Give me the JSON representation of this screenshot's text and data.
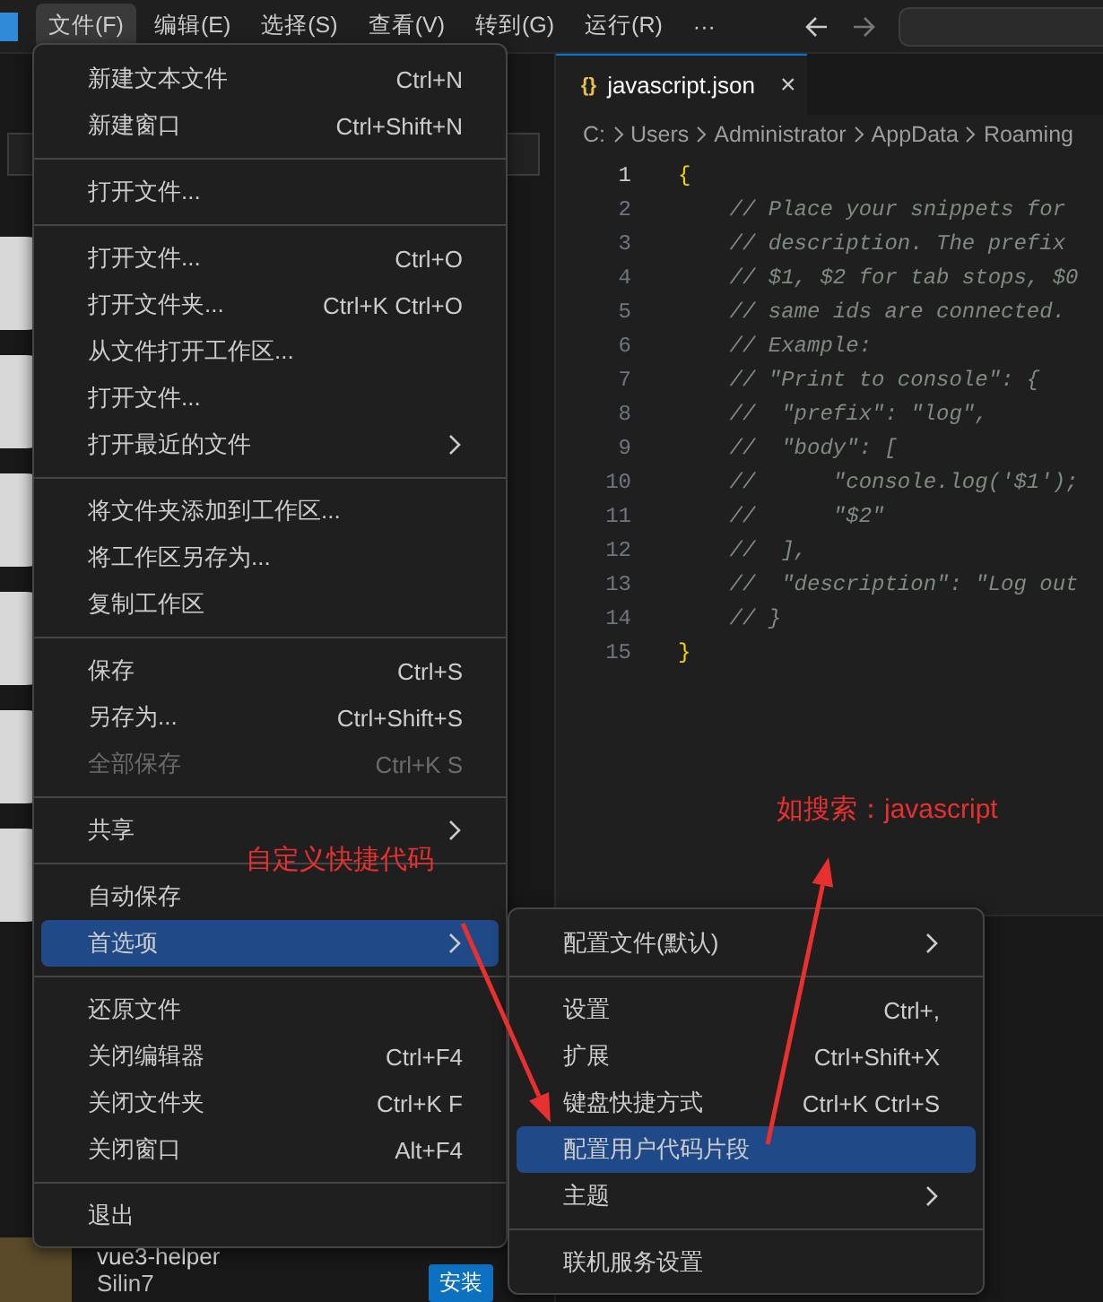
{
  "title_bar": {
    "menus": [
      {
        "label": "文件(F)",
        "selected": true
      },
      {
        "label": "编辑(E)",
        "selected": false
      },
      {
        "label": "选择(S)",
        "selected": false
      },
      {
        "label": "查看(V)",
        "selected": false
      },
      {
        "label": "转到(G)",
        "selected": false
      },
      {
        "label": "运行(R)",
        "selected": false
      },
      {
        "label": "···",
        "selected": false
      }
    ]
  },
  "sidebar": {
    "extension": {
      "name": "vue3-helper",
      "author": "Silin7",
      "button": "安装"
    }
  },
  "editor": {
    "tab": {
      "filename": "javascript.json",
      "icon": "{}",
      "close": "×"
    },
    "breadcrumb": [
      "C:",
      "Users",
      "Administrator",
      "AppData",
      "Roaming"
    ],
    "lines": [
      {
        "number": "1",
        "text": "{",
        "kind": "brace",
        "current": true
      },
      {
        "number": "2",
        "text": "    // Place your snippets for",
        "kind": "comment",
        "current": false
      },
      {
        "number": "3",
        "text": "    // description. The prefix",
        "kind": "comment",
        "current": false
      },
      {
        "number": "4",
        "text": "    // $1, $2 for tab stops, $0",
        "kind": "comment",
        "current": false
      },
      {
        "number": "5",
        "text": "    // same ids are connected.",
        "kind": "comment",
        "current": false
      },
      {
        "number": "6",
        "text": "    // Example:",
        "kind": "comment",
        "current": false
      },
      {
        "number": "7",
        "text": "    // \"Print to console\": {",
        "kind": "comment",
        "current": false
      },
      {
        "number": "8",
        "text": "    //  \"prefix\": \"log\",",
        "kind": "comment",
        "current": false
      },
      {
        "number": "9",
        "text": "    //  \"body\": [",
        "kind": "comment",
        "current": false
      },
      {
        "number": "10",
        "text": "    //      \"console.log('$1');",
        "kind": "comment",
        "current": false
      },
      {
        "number": "11",
        "text": "    //      \"$2\"",
        "kind": "comment",
        "current": false
      },
      {
        "number": "12",
        "text": "    //  ],",
        "kind": "comment",
        "current": false
      },
      {
        "number": "13",
        "text": "    //  \"description\": \"Log out",
        "kind": "comment",
        "current": false
      },
      {
        "number": "14",
        "text": "    // }",
        "kind": "comment",
        "current": false
      },
      {
        "number": "15",
        "text": "}",
        "kind": "brace",
        "current": false
      }
    ]
  },
  "file_menu": {
    "items": [
      {
        "kind": "item",
        "label": "新建文本文件",
        "shortcut": "Ctrl+N",
        "submenu": false,
        "disabled": false,
        "selected": false
      },
      {
        "kind": "item",
        "label": "新建窗口",
        "shortcut": "Ctrl+Shift+N",
        "submenu": false,
        "disabled": false,
        "selected": false
      },
      {
        "kind": "separator"
      },
      {
        "kind": "item",
        "label": "打开文件...",
        "submenu": false,
        "disabled": false,
        "selected": false
      },
      {
        "kind": "separator"
      },
      {
        "kind": "item",
        "label": "打开文件...",
        "shortcut": "Ctrl+O",
        "submenu": false,
        "disabled": false,
        "selected": false
      },
      {
        "kind": "item",
        "label": "打开文件夹...",
        "shortcut": "Ctrl+K Ctrl+O",
        "submenu": false,
        "disabled": false,
        "selected": false
      },
      {
        "kind": "item",
        "label": "从文件打开工作区...",
        "submenu": false,
        "disabled": false,
        "selected": false
      },
      {
        "kind": "item",
        "label": "打开文件...",
        "submenu": false,
        "disabled": false,
        "selected": false
      },
      {
        "kind": "item",
        "label": "打开最近的文件",
        "submenu": true,
        "disabled": false,
        "selected": false
      },
      {
        "kind": "separator"
      },
      {
        "kind": "item",
        "label": "将文件夹添加到工作区...",
        "submenu": false,
        "disabled": false,
        "selected": false
      },
      {
        "kind": "item",
        "label": "将工作区另存为...",
        "submenu": false,
        "disabled": false,
        "selected": false
      },
      {
        "kind": "item",
        "label": "复制工作区",
        "submenu": false,
        "disabled": false,
        "selected": false
      },
      {
        "kind": "separator"
      },
      {
        "kind": "item",
        "label": "保存",
        "shortcut": "Ctrl+S",
        "submenu": false,
        "disabled": false,
        "selected": false
      },
      {
        "kind": "item",
        "label": "另存为...",
        "shortcut": "Ctrl+Shift+S",
        "submenu": false,
        "disabled": false,
        "selected": false
      },
      {
        "kind": "item",
        "label": "全部保存",
        "shortcut": "Ctrl+K S",
        "submenu": false,
        "disabled": true,
        "selected": false
      },
      {
        "kind": "separator"
      },
      {
        "kind": "item",
        "label": "共享",
        "submenu": true,
        "disabled": false,
        "selected": false
      },
      {
        "kind": "separator"
      },
      {
        "kind": "item",
        "label": "自动保存",
        "submenu": false,
        "disabled": false,
        "selected": false
      },
      {
        "kind": "item",
        "label": "首选项",
        "submenu": true,
        "disabled": false,
        "selected": true
      },
      {
        "kind": "separator"
      },
      {
        "kind": "item",
        "label": "还原文件",
        "submenu": false,
        "disabled": false,
        "selected": false
      },
      {
        "kind": "item",
        "label": "关闭编辑器",
        "shortcut": "Ctrl+F4",
        "submenu": false,
        "disabled": false,
        "selected": false
      },
      {
        "kind": "item",
        "label": "关闭文件夹",
        "shortcut": "Ctrl+K F",
        "submenu": false,
        "disabled": false,
        "selected": false
      },
      {
        "kind": "item",
        "label": "关闭窗口",
        "shortcut": "Alt+F4",
        "submenu": false,
        "disabled": false,
        "selected": false
      },
      {
        "kind": "separator"
      },
      {
        "kind": "item",
        "label": "退出",
        "submenu": false,
        "disabled": false,
        "selected": false
      }
    ]
  },
  "preferences_submenu": {
    "items": [
      {
        "kind": "item",
        "label": "配置文件(默认)",
        "submenu": true,
        "disabled": false,
        "selected": false
      },
      {
        "kind": "separator"
      },
      {
        "kind": "item",
        "label": "设置",
        "shortcut": "Ctrl+,",
        "submenu": false,
        "disabled": false,
        "selected": false
      },
      {
        "kind": "item",
        "label": "扩展",
        "shortcut": "Ctrl+Shift+X",
        "submenu": false,
        "disabled": false,
        "selected": false
      },
      {
        "kind": "item",
        "label": "键盘快捷方式",
        "shortcut": "Ctrl+K Ctrl+S",
        "submenu": false,
        "disabled": false,
        "selected": false
      },
      {
        "kind": "item",
        "label": "配置用户代码片段",
        "submenu": false,
        "disabled": false,
        "selected": true
      },
      {
        "kind": "item",
        "label": "主题",
        "submenu": true,
        "disabled": false,
        "selected": false
      },
      {
        "kind": "separator"
      },
      {
        "kind": "item",
        "label": "联机服务设置",
        "submenu": false,
        "disabled": false,
        "selected": false
      }
    ]
  },
  "annotations": [
    {
      "text": "自定义快捷代码"
    },
    {
      "text": "如搜索：javascript"
    }
  ]
}
